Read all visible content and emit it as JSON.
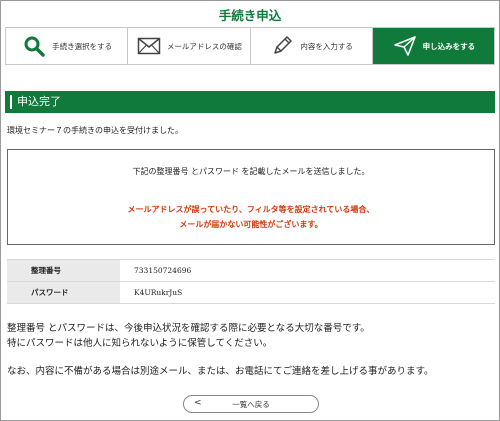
{
  "page_title": "手続き申込",
  "steps": [
    {
      "label": "手続き選択をする",
      "icon": "search-icon"
    },
    {
      "label": "メールアドレスの確認",
      "icon": "envelope-icon"
    },
    {
      "label": "内容を入力する",
      "icon": "pencil-icon"
    },
    {
      "label": "申し込みをする",
      "icon": "send-icon",
      "active": true
    }
  ],
  "section_title": "申込完了",
  "intro_text": "環境セミナー７の手続きの申込を受付けました。",
  "notice": {
    "line1": "下記の整理番号 とパスワード を記載したメールを送信しました。",
    "warning_line1": "メールアドレスが誤っていたり、フィルタ等を設定されている場合、",
    "warning_line2": "メールが届かない可能性がございます。",
    "warning_color": "#d4380d"
  },
  "info_table": [
    {
      "label": "整理番号",
      "value": "733150724696"
    },
    {
      "label": "パスワード",
      "value": "K4URukrJuS"
    }
  ],
  "body_lines": [
    "整理番号 とパスワードは、今後申込状況を確認する際に必要となる大切な番号です。",
    "特にパスワードは他人に知られないように保管してください。",
    "なお、内容に不備がある場合は別途メール、または、お電話にてご連絡を差し上げる事があります。"
  ],
  "back_button": {
    "chevron": "<",
    "label": "一覧へ戻る"
  },
  "colors": {
    "brand_green": "#0f7a3a"
  }
}
